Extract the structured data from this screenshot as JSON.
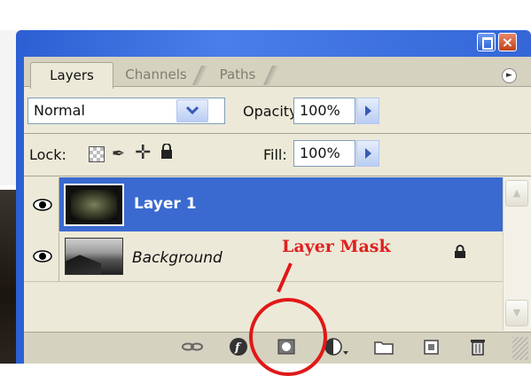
{
  "window": {
    "min_button_icon": "restore-icon",
    "close_button_label": "×"
  },
  "tabs": [
    {
      "label": "Layers",
      "active": true
    },
    {
      "label": "Channels",
      "active": false
    },
    {
      "label": "Paths",
      "active": false
    }
  ],
  "palette_menu_icon": "palette-menu-arrow-icon",
  "blend_mode": {
    "value": "Normal"
  },
  "opacity": {
    "label": "Opacity:",
    "value": "100%"
  },
  "lock": {
    "label": "Lock:",
    "icons": [
      "lock-transparent-icon",
      "lock-paint-icon",
      "lock-move-icon",
      "lock-all-icon"
    ]
  },
  "fill": {
    "label": "Fill:",
    "value": "100%"
  },
  "layers": [
    {
      "name": "Layer 1",
      "selected": true,
      "visible": true,
      "locked": false
    },
    {
      "name": "Background",
      "selected": false,
      "visible": true,
      "locked": true
    }
  ],
  "toolbar_icons": [
    "link-layers-icon",
    "layer-style-icon",
    "add-layer-mask-icon",
    "adjustment-layer-icon",
    "new-group-icon",
    "new-layer-icon",
    "trash-icon"
  ],
  "annotation": {
    "label": "Layer Mask",
    "color": "#e02020"
  },
  "colors": {
    "selection": "#3a6ad0",
    "panel_bg": "#ece9d8",
    "titlebar": "#2c5fd3"
  }
}
